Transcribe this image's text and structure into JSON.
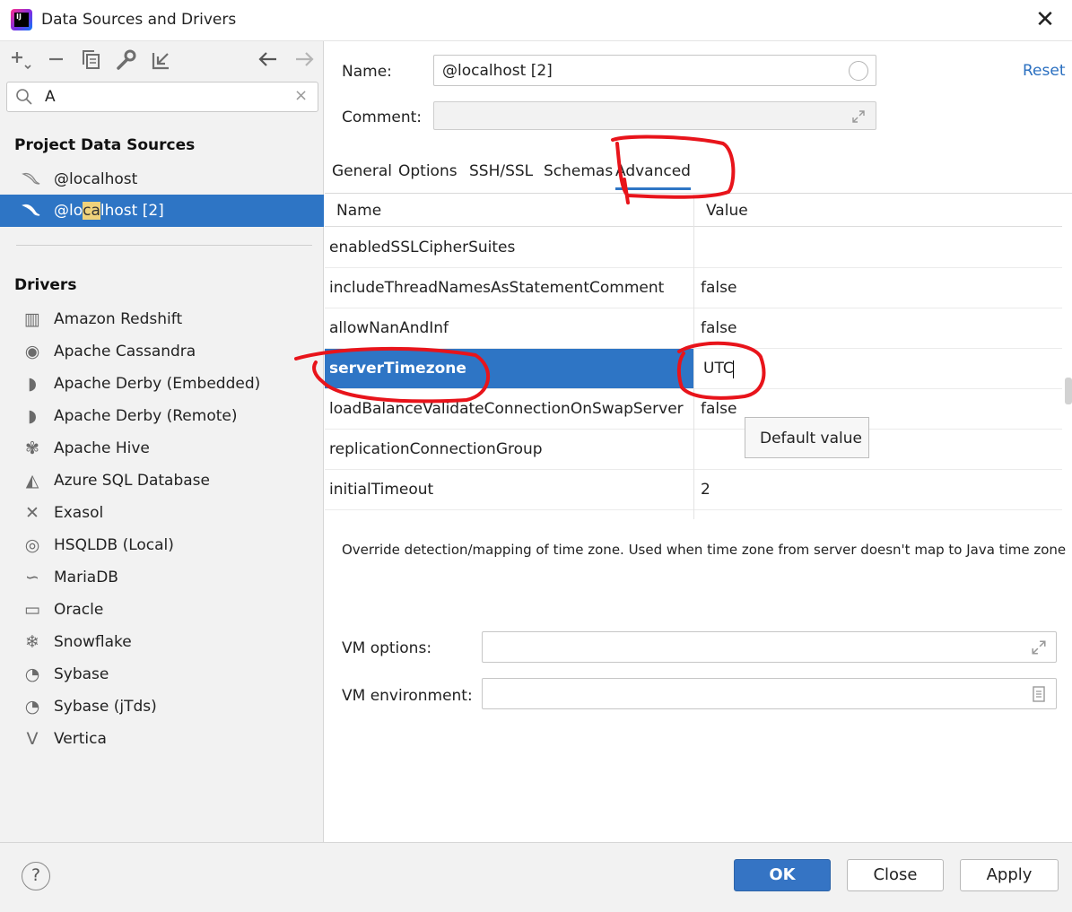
{
  "window": {
    "title": "Data Sources and Drivers",
    "app_icon_text": "IJ"
  },
  "toolbar": {
    "icons": [
      "add-icon",
      "remove-icon",
      "duplicate-icon",
      "wrench-icon",
      "import-icon",
      "back-arrow-icon",
      "forward-arrow-icon"
    ]
  },
  "search": {
    "value": "A",
    "clear": "×"
  },
  "project_sources": {
    "title": "Project Data Sources",
    "items": [
      {
        "label": "@localhost"
      },
      {
        "pre": "@lo",
        "hl": "ca",
        "post": "lhost [2]"
      }
    ]
  },
  "drivers": {
    "title": "Drivers",
    "items": [
      {
        "label": "Amazon Redshift",
        "icon": "redshift-icon",
        "glyph": "▥"
      },
      {
        "label": "Apache Cassandra",
        "icon": "cassandra-eye-icon",
        "glyph": "◉"
      },
      {
        "label": "Apache Derby (Embedded)",
        "icon": "derby-hat-icon",
        "glyph": "◗"
      },
      {
        "label": "Apache Derby (Remote)",
        "icon": "derby-hat-icon",
        "glyph": "◗"
      },
      {
        "label": "Apache Hive",
        "icon": "hive-bee-icon",
        "glyph": "✾"
      },
      {
        "label": "Azure SQL Database",
        "icon": "azure-icon",
        "glyph": "◭"
      },
      {
        "label": "Exasol",
        "icon": "exasol-x-icon",
        "glyph": "✕"
      },
      {
        "label": "HSQLDB (Local)",
        "icon": "hsqldb-icon",
        "glyph": "◎"
      },
      {
        "label": "MariaDB",
        "icon": "mariadb-seal-icon",
        "glyph": "∽"
      },
      {
        "label": "Oracle",
        "icon": "oracle-icon",
        "glyph": "▭"
      },
      {
        "label": "Snowflake",
        "icon": "snowflake-icon",
        "glyph": "❄"
      },
      {
        "label": "Sybase",
        "icon": "sybase-icon",
        "glyph": "◔"
      },
      {
        "label": "Sybase (jTds)",
        "icon": "sybase-icon",
        "glyph": "◔"
      },
      {
        "label": "Vertica",
        "icon": "vertica-icon",
        "glyph": "V"
      }
    ]
  },
  "form": {
    "name_label": "Name:",
    "name_value": "@localhost [2]",
    "comment_label": "Comment:",
    "reset": "Reset"
  },
  "tabs": [
    {
      "label": "General"
    },
    {
      "label": "Options"
    },
    {
      "label": "SSH/SSL"
    },
    {
      "label": "Schemas"
    },
    {
      "label": "Advanced",
      "active": true
    }
  ],
  "grid": {
    "col_name": "Name",
    "col_value": "Value",
    "rows": [
      {
        "name": "enabledSSLCipherSuites",
        "value": ""
      },
      {
        "name": "includeThreadNamesAsStatementComment",
        "value": "false"
      },
      {
        "name": "allowNanAndInf",
        "value": "false"
      },
      {
        "name": "serverTimezone",
        "value": "UTC",
        "selected": true
      },
      {
        "name": "loadBalanceValidateConnectionOnSwapServer",
        "value": "false"
      },
      {
        "name": "replicationConnectionGroup",
        "value": ""
      },
      {
        "name": "initialTimeout",
        "value": "2"
      },
      {
        "name": "",
        "value": ""
      }
    ],
    "tooltip": "Default value"
  },
  "description": "Override detection/mapping of time zone. Used when time zone from server doesn't map to Java time zone",
  "vm": {
    "options_label": "VM options:",
    "environment_label": "VM environment:"
  },
  "footer": {
    "help": "?",
    "ok": "OK",
    "close": "Close",
    "apply": "Apply"
  },
  "colors": {
    "selection": "#2e75c5",
    "link": "#2a6fc0",
    "annotation": "#e8141b",
    "primary_button": "#3574c4"
  }
}
